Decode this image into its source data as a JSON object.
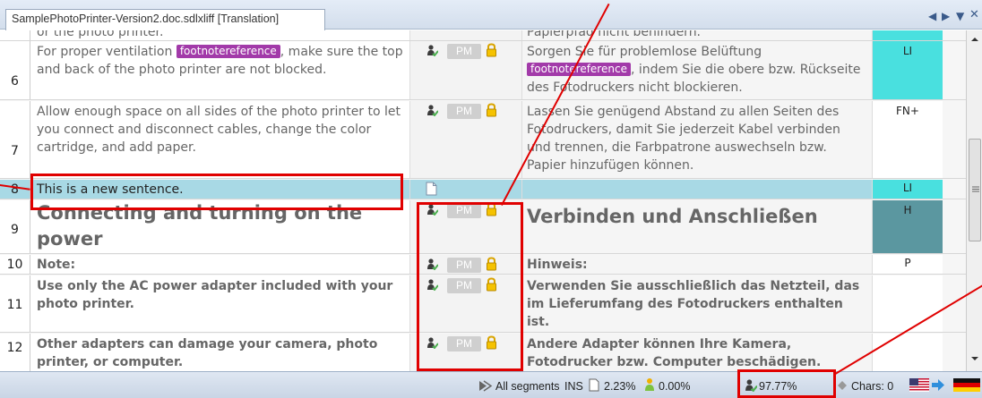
{
  "tab": {
    "title": "SamplePhotoPrinter-Version2.doc.sdlxliff [Translation]"
  },
  "tab_controls": {
    "prev": "◀",
    "next": "▶",
    "menu": "▼",
    "close": "✕"
  },
  "statuses": {
    "pm_label": "PM"
  },
  "rows": [
    {
      "num": "",
      "src": "or the photo printer.",
      "tgt": "Papierpfad nicht behindern.",
      "disp": ""
    },
    {
      "num": "6",
      "src_a": "For proper ventilation ",
      "tag": "footnotereference",
      "src_b": ", make sure the top and back of the photo printer are not blocked.",
      "tgt_a": "Sorgen Sie für problemlose Belüftung ",
      "tgt_b": ", indem Sie die obere bzw. Rückseite des Fotodruckers nicht blockieren.",
      "disp": "LI"
    },
    {
      "num": "7",
      "src": "Allow enough space on all sides of the photo printer to let you connect and disconnect cables, change the color cartridge, and add paper.",
      "tgt": "Lassen Sie genügend Abstand zu allen Seiten des Fotodruckers, damit Sie jederzeit Kabel verbinden und trennen, die Farbpatrone auswechseln bzw. Papier hinzufügen können.",
      "disp": "FN+"
    },
    {
      "num": "8",
      "src": "This is a new sentence.",
      "tgt": "",
      "disp": "LI"
    },
    {
      "num": "9",
      "src": "Connecting and turning on the power",
      "tgt": "Verbinden und Anschließen",
      "disp": "H"
    },
    {
      "num": "10",
      "src": "Note:",
      "tgt": "Hinweis:",
      "disp": "P"
    },
    {
      "num": "11",
      "src": "Use only the AC power adapter included with your photo printer.",
      "tgt": "Verwenden Sie ausschließlich das Netzteil, das im Lieferumfang des Fotodruckers enthalten ist.",
      "disp": ""
    },
    {
      "num": "12",
      "src": "Other adapters can damage your camera, photo printer, or computer.",
      "tgt": "Andere Adapter können Ihre Kamera, Fotodrucker bzw. Computer beschädigen.",
      "disp": ""
    }
  ],
  "status_bar": {
    "filter": "All segments",
    "mode": "INS",
    "pct_new": "2.23%",
    "pct_fuzzy": "0.00%",
    "pct_translated": "97.77%",
    "chars": "Chars: 0"
  },
  "colors": {
    "selected_row": "#a8d9e5",
    "tag": "#a23aa9",
    "annotation": "#e00000",
    "disp_cyan": "#49e0df",
    "disp_teal": "#5b97a0"
  },
  "icons": [
    "filter-icon",
    "document-icon",
    "fuzzy-icon",
    "translated-person-icon",
    "us-flag-icon",
    "arrow-right-icon",
    "german-flag-icon",
    "lock-icon",
    "person-check-icon"
  ]
}
